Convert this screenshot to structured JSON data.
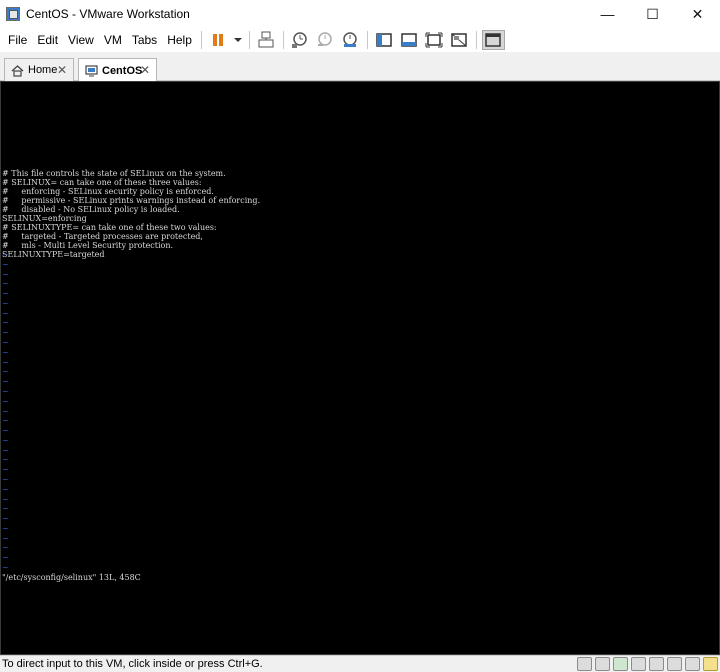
{
  "window": {
    "title": "CentOS - VMware Workstation",
    "minimize_glyph": "—",
    "maximize_glyph": "☐",
    "close_glyph": "✕"
  },
  "menu": {
    "file": "File",
    "edit": "Edit",
    "view": "View",
    "vm": "VM",
    "tabs": "Tabs",
    "help": "Help"
  },
  "toolbar": {
    "icons": [
      "pause-icon",
      "dropdown-arrow-icon",
      "send-ctrl-alt-del-icon",
      "snapshot-take-icon",
      "snapshot-revert-icon",
      "snapshot-manager-icon",
      "library-view-icon",
      "thumbnail-bar-icon",
      "full-screen-icon",
      "unity-icon",
      "console-view-icon"
    ]
  },
  "tabs": [
    {
      "label": "Home",
      "icon": "home-icon",
      "close": "✕",
      "active": false
    },
    {
      "label": "CentOS",
      "icon": "vm-icon",
      "close": "✕",
      "active": true
    }
  ],
  "terminal": {
    "lines": [
      "",
      "# This file controls the state of SELinux on the system.",
      "# SELINUX= can take one of these three values:",
      "#     enforcing - SELinux security policy is enforced.",
      "#     permissive - SELinux prints warnings instead of enforcing.",
      "#     disabled - No SELinux policy is loaded.",
      "SELINUX=enforcing",
      "# SELINUXTYPE= can take one of these two values:",
      "#     targeted - Targeted processes are protected,",
      "#     mls - Multi Level Security protection.",
      "SELINUXTYPE=targeted"
    ],
    "tilde_char": "~",
    "tilde_count": 33,
    "status_line": "\"/etc/sysconfig/selinux\" 13L, 458C"
  },
  "statusbar": {
    "text": "To direct input to this VM, click inside or press Ctrl+G.",
    "device_icons": [
      "hard-disk-icon",
      "cd-dvd-icon",
      "network-adapter-icon",
      "usb-controller-icon",
      "printer-icon",
      "sound-card-icon",
      "display-icon",
      "message-log-icon"
    ]
  },
  "colors": {
    "console_bg": "#000000",
    "console_text": "#d9d9d9",
    "tilde": "#2a66d8"
  }
}
